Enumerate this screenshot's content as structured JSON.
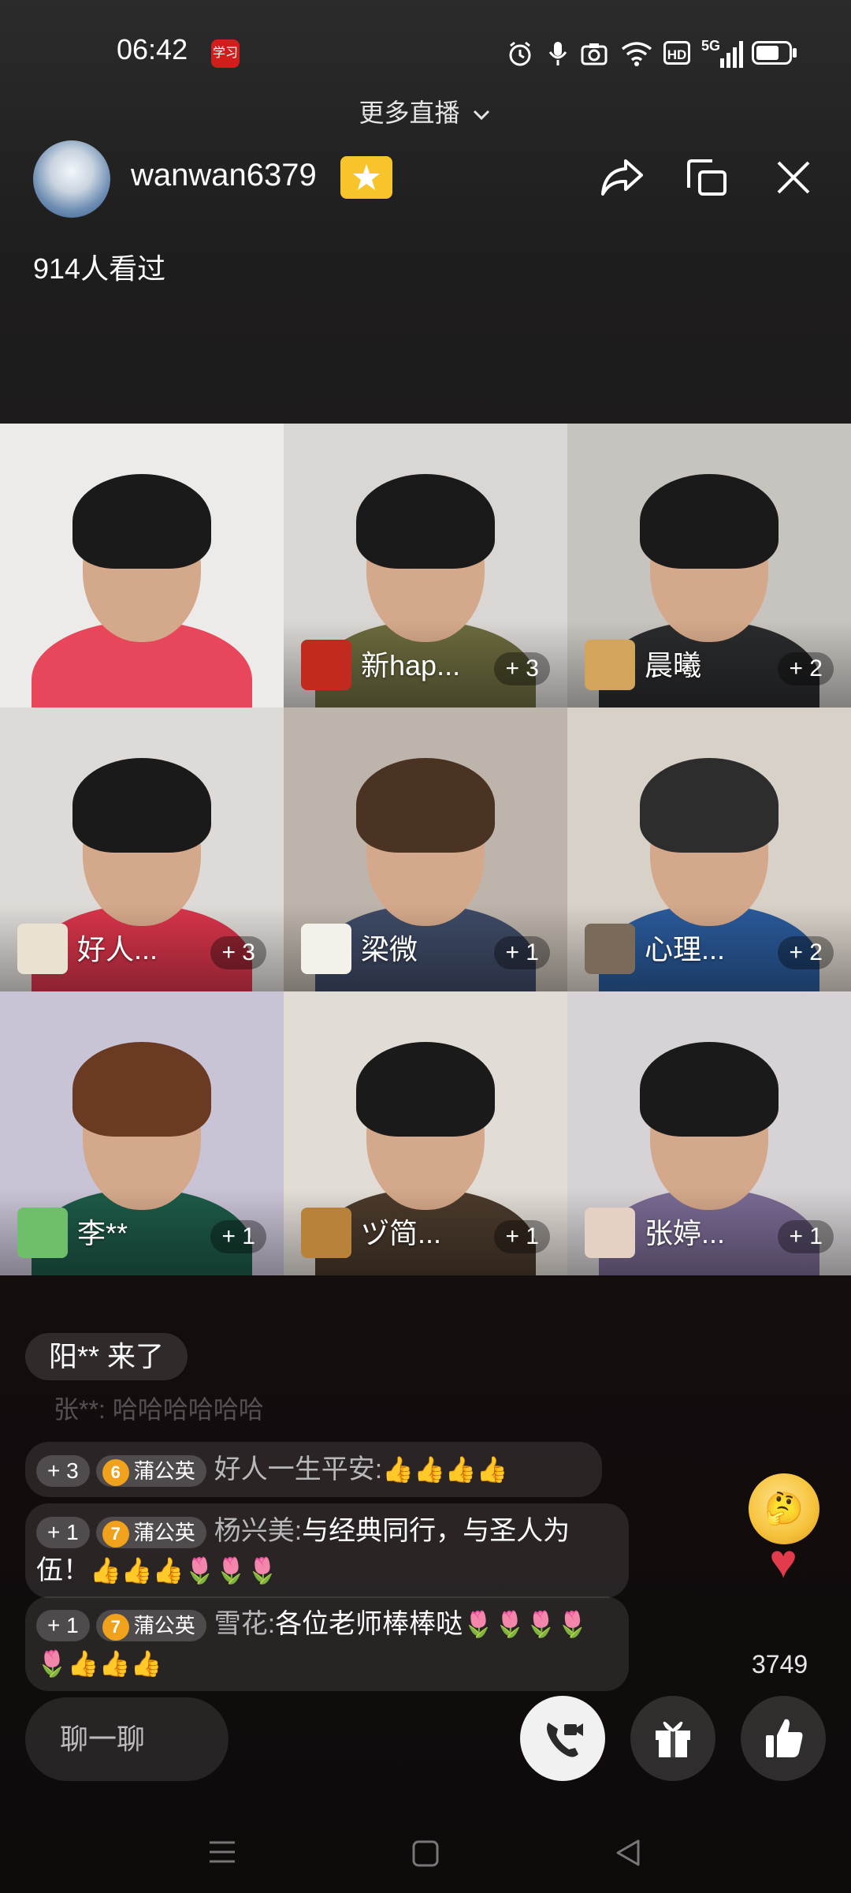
{
  "status_bar": {
    "time": "06:42",
    "app_badge": "学习",
    "hd": "HD",
    "network": "5G"
  },
  "header": {
    "more_live": "更多直播",
    "host_name": "wanwan6379",
    "viewers": "914人看过"
  },
  "tiles": [
    {
      "name": "",
      "score": "",
      "body_color": "#e8465a",
      "bg": "#ecebea"
    },
    {
      "name": "新hap...",
      "score": "+ 3",
      "body_color": "#6b6a3e",
      "bg": "#d9d6d3"
    },
    {
      "name": "晨曦",
      "score": "+ 2",
      "body_color": "#2a2b2d",
      "bg": "#c7c3bf"
    },
    {
      "name": "好人...",
      "score": "+ 3",
      "body_color": "#d8344a",
      "bg": "#dedad7"
    },
    {
      "name": "梁微",
      "score": "+ 1",
      "body_color": "#3e4a66",
      "bg": "#bdb4ab"
    },
    {
      "name": "心理...",
      "score": "+ 2",
      "body_color": "#2a5a9a",
      "bg": "#d8d1c8"
    },
    {
      "name": "李**",
      "score": "+ 1",
      "body_color": "#1d5a48",
      "bg": "#c9c3d6"
    },
    {
      "name": "ヅ简...",
      "score": "+ 1",
      "body_color": "#4b3a2c",
      "bg": "#e2dcd6"
    },
    {
      "name": "张婷...",
      "score": "+ 1",
      "body_color": "#7a6a93",
      "bg": "#d6d2d5"
    }
  ],
  "chat": {
    "join_notice": "阳** 来了",
    "faded_line": "张**: 哈哈哈哈哈哈",
    "messages": [
      {
        "score": "+ 3",
        "level": "6",
        "group": "蒲公英",
        "user": "好人一生平安:",
        "text": "",
        "emoji": "👍👍👍👍"
      },
      {
        "score": "+ 1",
        "level": "7",
        "group": "蒲公英",
        "user": "杨兴美:",
        "text": "与经典同行，与圣人为伍！",
        "emoji": "👍👍👍🌷🌷🌷"
      },
      {
        "score": "+ 1",
        "level": "7",
        "group": "蒲公英",
        "user": "雪花:",
        "text": "各位老师棒棒哒",
        "emoji": "🌷🌷🌷🌷🌷👍👍👍"
      }
    ]
  },
  "likes": {
    "count": "3749"
  },
  "bottom": {
    "input_placeholder": "聊一聊"
  }
}
